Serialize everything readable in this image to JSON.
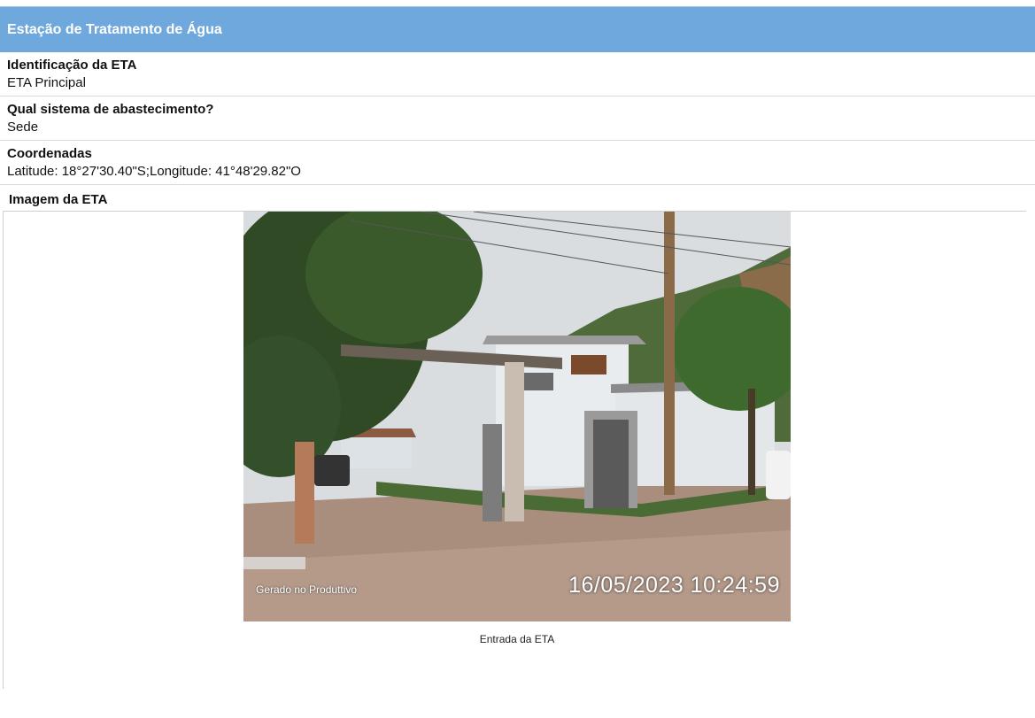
{
  "section": {
    "title": "Estação de Tratamento de Água"
  },
  "fields": [
    {
      "label": "Identificação da ETA",
      "value": "ETA Principal"
    },
    {
      "label": "Qual sistema de abastecimento?",
      "value": "Sede"
    },
    {
      "label": "Coordenadas",
      "value": "Latitude: 18°27'30.40\"S;Longitude: 41°48'29.82\"O"
    }
  ],
  "image": {
    "label": "Imagem da ETA",
    "stamp_left": "Gerado no Produttivo",
    "stamp_right": "16/05/2023 10:24:59",
    "caption": "Entrada da ETA"
  }
}
